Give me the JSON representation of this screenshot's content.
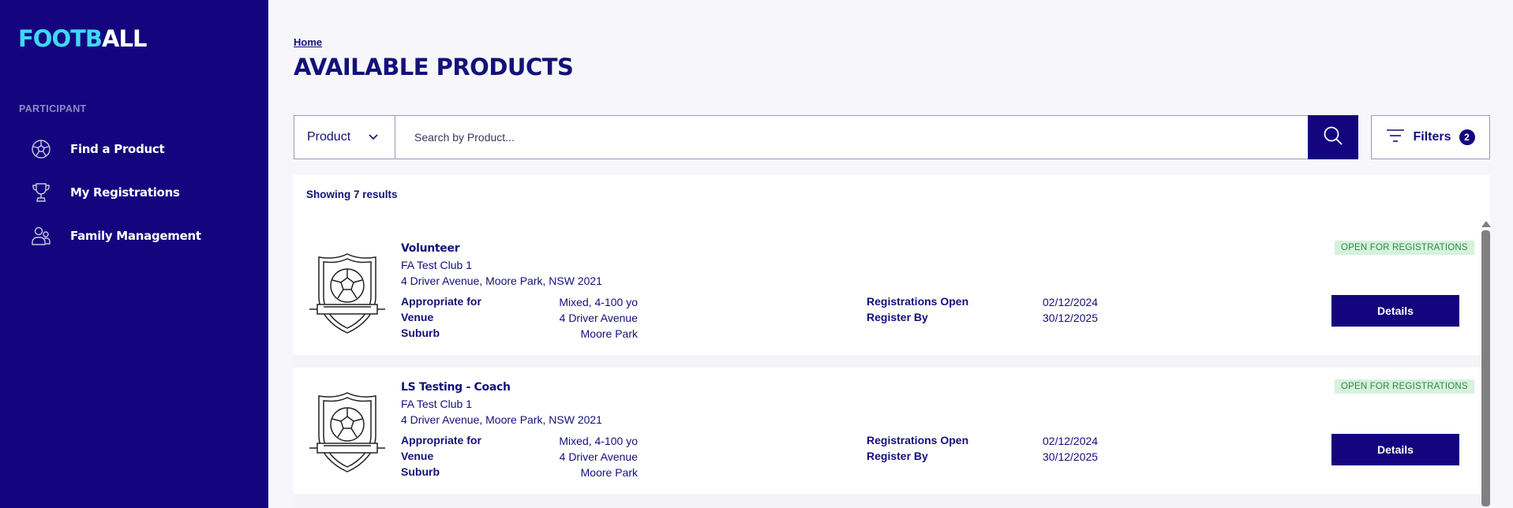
{
  "app": {
    "logo_part1": "FOOTB",
    "logo_part2": "ALL"
  },
  "sidebar": {
    "section_label": "PARTICIPANT",
    "items": [
      {
        "label": "Find a Product",
        "icon": "soccer-ball-icon"
      },
      {
        "label": "My Registrations",
        "icon": "trophy-icon"
      },
      {
        "label": "Family Management",
        "icon": "family-icon"
      }
    ]
  },
  "header": {
    "breadcrumb": "Home",
    "title": "AVAILABLE PRODUCTS"
  },
  "search": {
    "type_value": "Product",
    "placeholder": "Search by Product...",
    "filters_label": "Filters",
    "filters_count": "2"
  },
  "results": {
    "count_text": "Showing 7 results",
    "items": [
      {
        "name": "Volunteer",
        "club": "FA Test Club 1",
        "address": "4 Driver Avenue, Moore Park, NSW 2021",
        "appropriate_label": "Appropriate for",
        "appropriate_value": "Mixed, 4-100 yo",
        "venue_label": "Venue",
        "venue_value": "4 Driver Avenue",
        "suburb_label": "Suburb",
        "suburb_value": "Moore Park",
        "reg_open_label": "Registrations Open",
        "reg_open_value": "02/12/2024",
        "register_by_label": "Register By",
        "register_by_value": "30/12/2025",
        "status": "OPEN FOR REGISTRATIONS",
        "button": "Details"
      },
      {
        "name": "LS Testing - Coach",
        "club": "FA Test Club 1",
        "address": "4 Driver Avenue, Moore Park, NSW 2021",
        "appropriate_label": "Appropriate for",
        "appropriate_value": "Mixed, 4-100 yo",
        "venue_label": "Venue",
        "venue_value": "4 Driver Avenue",
        "suburb_label": "Suburb",
        "suburb_value": "Moore Park",
        "reg_open_label": "Registrations Open",
        "reg_open_value": "02/12/2024",
        "register_by_label": "Register By",
        "register_by_value": "30/12/2025",
        "status": "OPEN FOR REGISTRATIONS",
        "button": "Details"
      }
    ]
  },
  "colors": {
    "primary": "#14057f",
    "accent": "#3fd7f5",
    "status_bg": "#d6f1dc",
    "status_text": "#2e8a48"
  }
}
